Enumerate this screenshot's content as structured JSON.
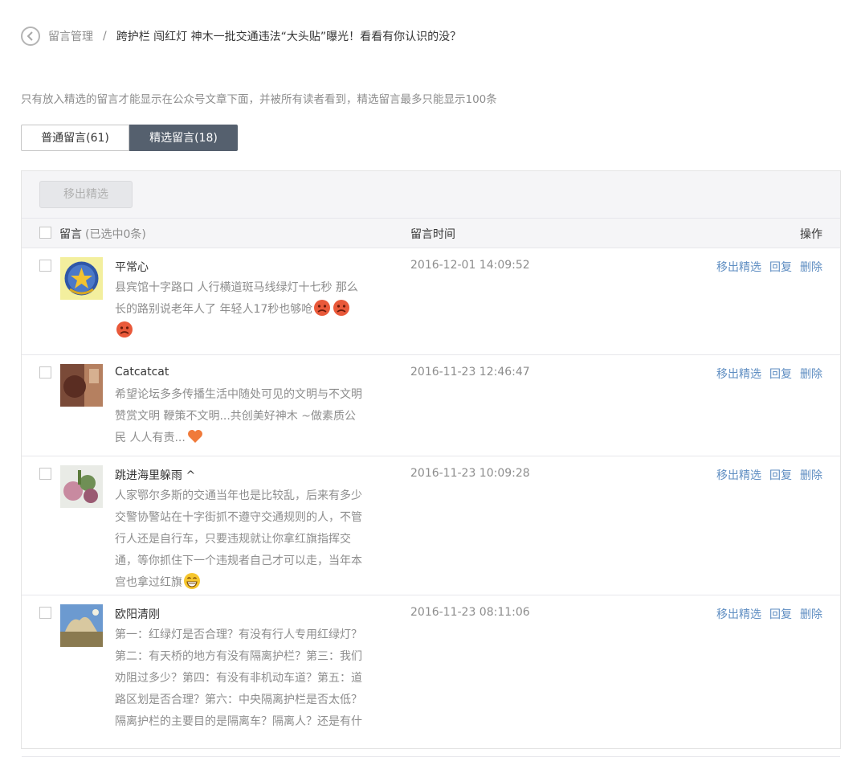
{
  "breadcrumb": {
    "parent": "留言管理",
    "separator": "/",
    "current": "跨护栏 闯红灯 神木一批交通违法“大头贴”曝光！看看有你认识的没？"
  },
  "notice": "只有放入精选的留言才能显示在公众号文章下面，并被所有读者看到，精选留言最多只能显示100条",
  "tabs": [
    {
      "label": "普通留言(61)",
      "active": false
    },
    {
      "label": "精选留言(18)",
      "active": true
    }
  ],
  "toolbar": {
    "remove_label": "移出精选"
  },
  "table": {
    "col_message": "留言",
    "selected_text": "(已选中0条)",
    "col_time": "留言时间",
    "col_ops": "操作"
  },
  "ops": {
    "remove": "移出精选",
    "reply": "回复",
    "delete": "删除"
  },
  "comments": [
    {
      "nick": "平常心",
      "line1": "县宾馆十字路口 人行横道斑马线绿灯十七秒 那么",
      "line2": "长的路别说老年人了 年轻人17秒也够呛",
      "time": "2016-12-01 14:09:52",
      "emojis": [
        "angry-face-emoji",
        "angry-face-emoji",
        "angry-face-emoji"
      ]
    },
    {
      "nick": "Catcatcat",
      "line1": "希望论坛多多传播生活中随处可见的文明与不文明",
      "line2": "赞赏文明 鞭策不文明...共创美好神木 ~做素质公",
      "line3": "民 人人有责...",
      "time": "2016-11-23 12:46:47",
      "emojis": [
        "heart-emoji"
      ]
    },
    {
      "nick": "跳进海里躲雨 ^",
      "line1": "人家鄂尔多斯的交通当年也是比较乱，后来有多少",
      "line2": "交警协警站在十字街抓不遵守交通规则的人，不管",
      "line3": "行人还是自行车，只要违规就让你拿红旗指挥交",
      "line4": "通，等你抓住下一个违规者自己才可以走，当年本",
      "line5": "宫也拿过红旗",
      "time": "2016-11-23 10:09:28",
      "emojis": [
        "grin-emoji"
      ]
    },
    {
      "nick": "欧阳清刚",
      "line1": "第一：红绿灯是否合理？有没有行人专用红绿灯？",
      "line2": "第二：有天桥的地方有没有隔离护栏？第三：我们",
      "line3": "劝阻过多少？第四：有没有非机动车道？第五：道",
      "line4": "路区划是否合理？第六：中央隔离护栏是否太低？",
      "line5": "隔离护栏的主要目的是隔离车？隔离人？还是有什",
      "time": "2016-11-23 08:11:06"
    }
  ]
}
